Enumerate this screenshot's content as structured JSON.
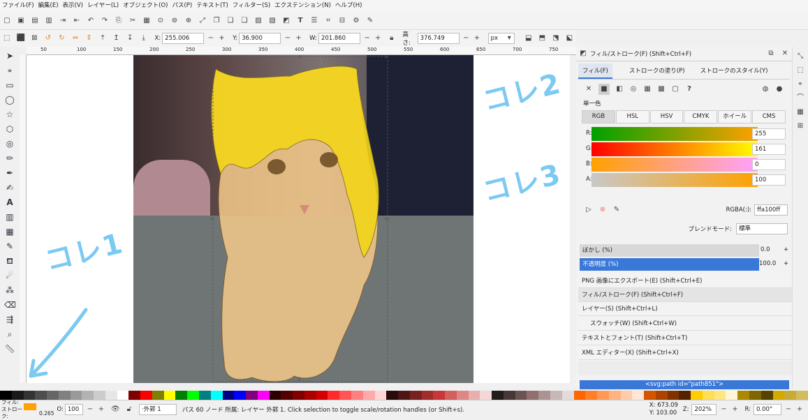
{
  "menu": [
    "ファイル(F)",
    "編集(E)",
    "表示(V)",
    "レイヤー(L)",
    "オブジェクト(O)",
    "パス(P)",
    "テキスト(T)",
    "フィルター(S)",
    "エクステンション(N)",
    "ヘルプ(H)"
  ],
  "ctrl": {
    "x_label": "X:",
    "x": "255.006",
    "y_label": "Y:",
    "y": "36.900",
    "w_label": "W:",
    "w": "201.860",
    "h_label": "高さ:",
    "h": "376.749",
    "unit": "px"
  },
  "ruler": [
    "50",
    "100",
    "150",
    "200",
    "250",
    "300",
    "350",
    "400",
    "450",
    "500",
    "550",
    "600",
    "650",
    "700",
    "750"
  ],
  "panel": {
    "title": "フィル/ストローク(F) (Shift+Ctrl+F)",
    "tabs": [
      "フィル(F)",
      "ストロークの塗り(P)",
      "ストロークのスタイル(Y)"
    ],
    "flat_label": "単一色",
    "modes": [
      "RGB",
      "HSL",
      "HSV",
      "CMYK",
      "ホイール",
      "CMS"
    ],
    "channels": [
      {
        "label": "R:",
        "value": "255"
      },
      {
        "label": "G:",
        "value": "161"
      },
      {
        "label": "B:",
        "value": "0"
      },
      {
        "label": "A:",
        "value": "100"
      }
    ],
    "rgba_label": "RGBA(:):",
    "rgba": "ffa100ff",
    "blend_label": "ブレンドモード:",
    "blend": "標準",
    "blur_label": "ぼかし (%)",
    "blur": "0.0",
    "opacity_label": "不透明度 (%)",
    "opacity": "100.0"
  },
  "docks": [
    "PNG 画像にエクスポート(E) (Shift+Ctrl+E)",
    "フィル/ストローク(F) (Shift+Ctrl+F)",
    "レイヤー(S) (Shift+Ctrl+L)",
    "スウォッチ(W) (Shift+Ctrl+W)",
    "テキストとフォント(T) (Shift+Ctrl+T)",
    "XML エディター(X) (Shift+Ctrl+X)"
  ],
  "xml_node": "<svg:path id=\"path851\">",
  "status": {
    "fill_label": "フィル:",
    "stroke_label": "ストローク:",
    "stroke_width": "0.265",
    "o_label": "O:",
    "opacity": "100",
    "layer": "·外郭 1",
    "message": "パス 60 ノード 所属: レイヤー 外郭 1. Click selection to toggle scale/rotation handles (or Shift+s).",
    "x_label": "X:",
    "x": "673.09",
    "y_label": "Y:",
    "y": "103.00",
    "z_label": "Z:",
    "zoom": "202%",
    "r_label": "R:",
    "rotation": "0.00°"
  },
  "annotations": [
    "コレ1",
    "コレ2",
    "コレ3"
  ],
  "colors": {
    "fill": "#ffa100",
    "accent": "#3a78d8",
    "annotation": "#7cc9f2"
  }
}
